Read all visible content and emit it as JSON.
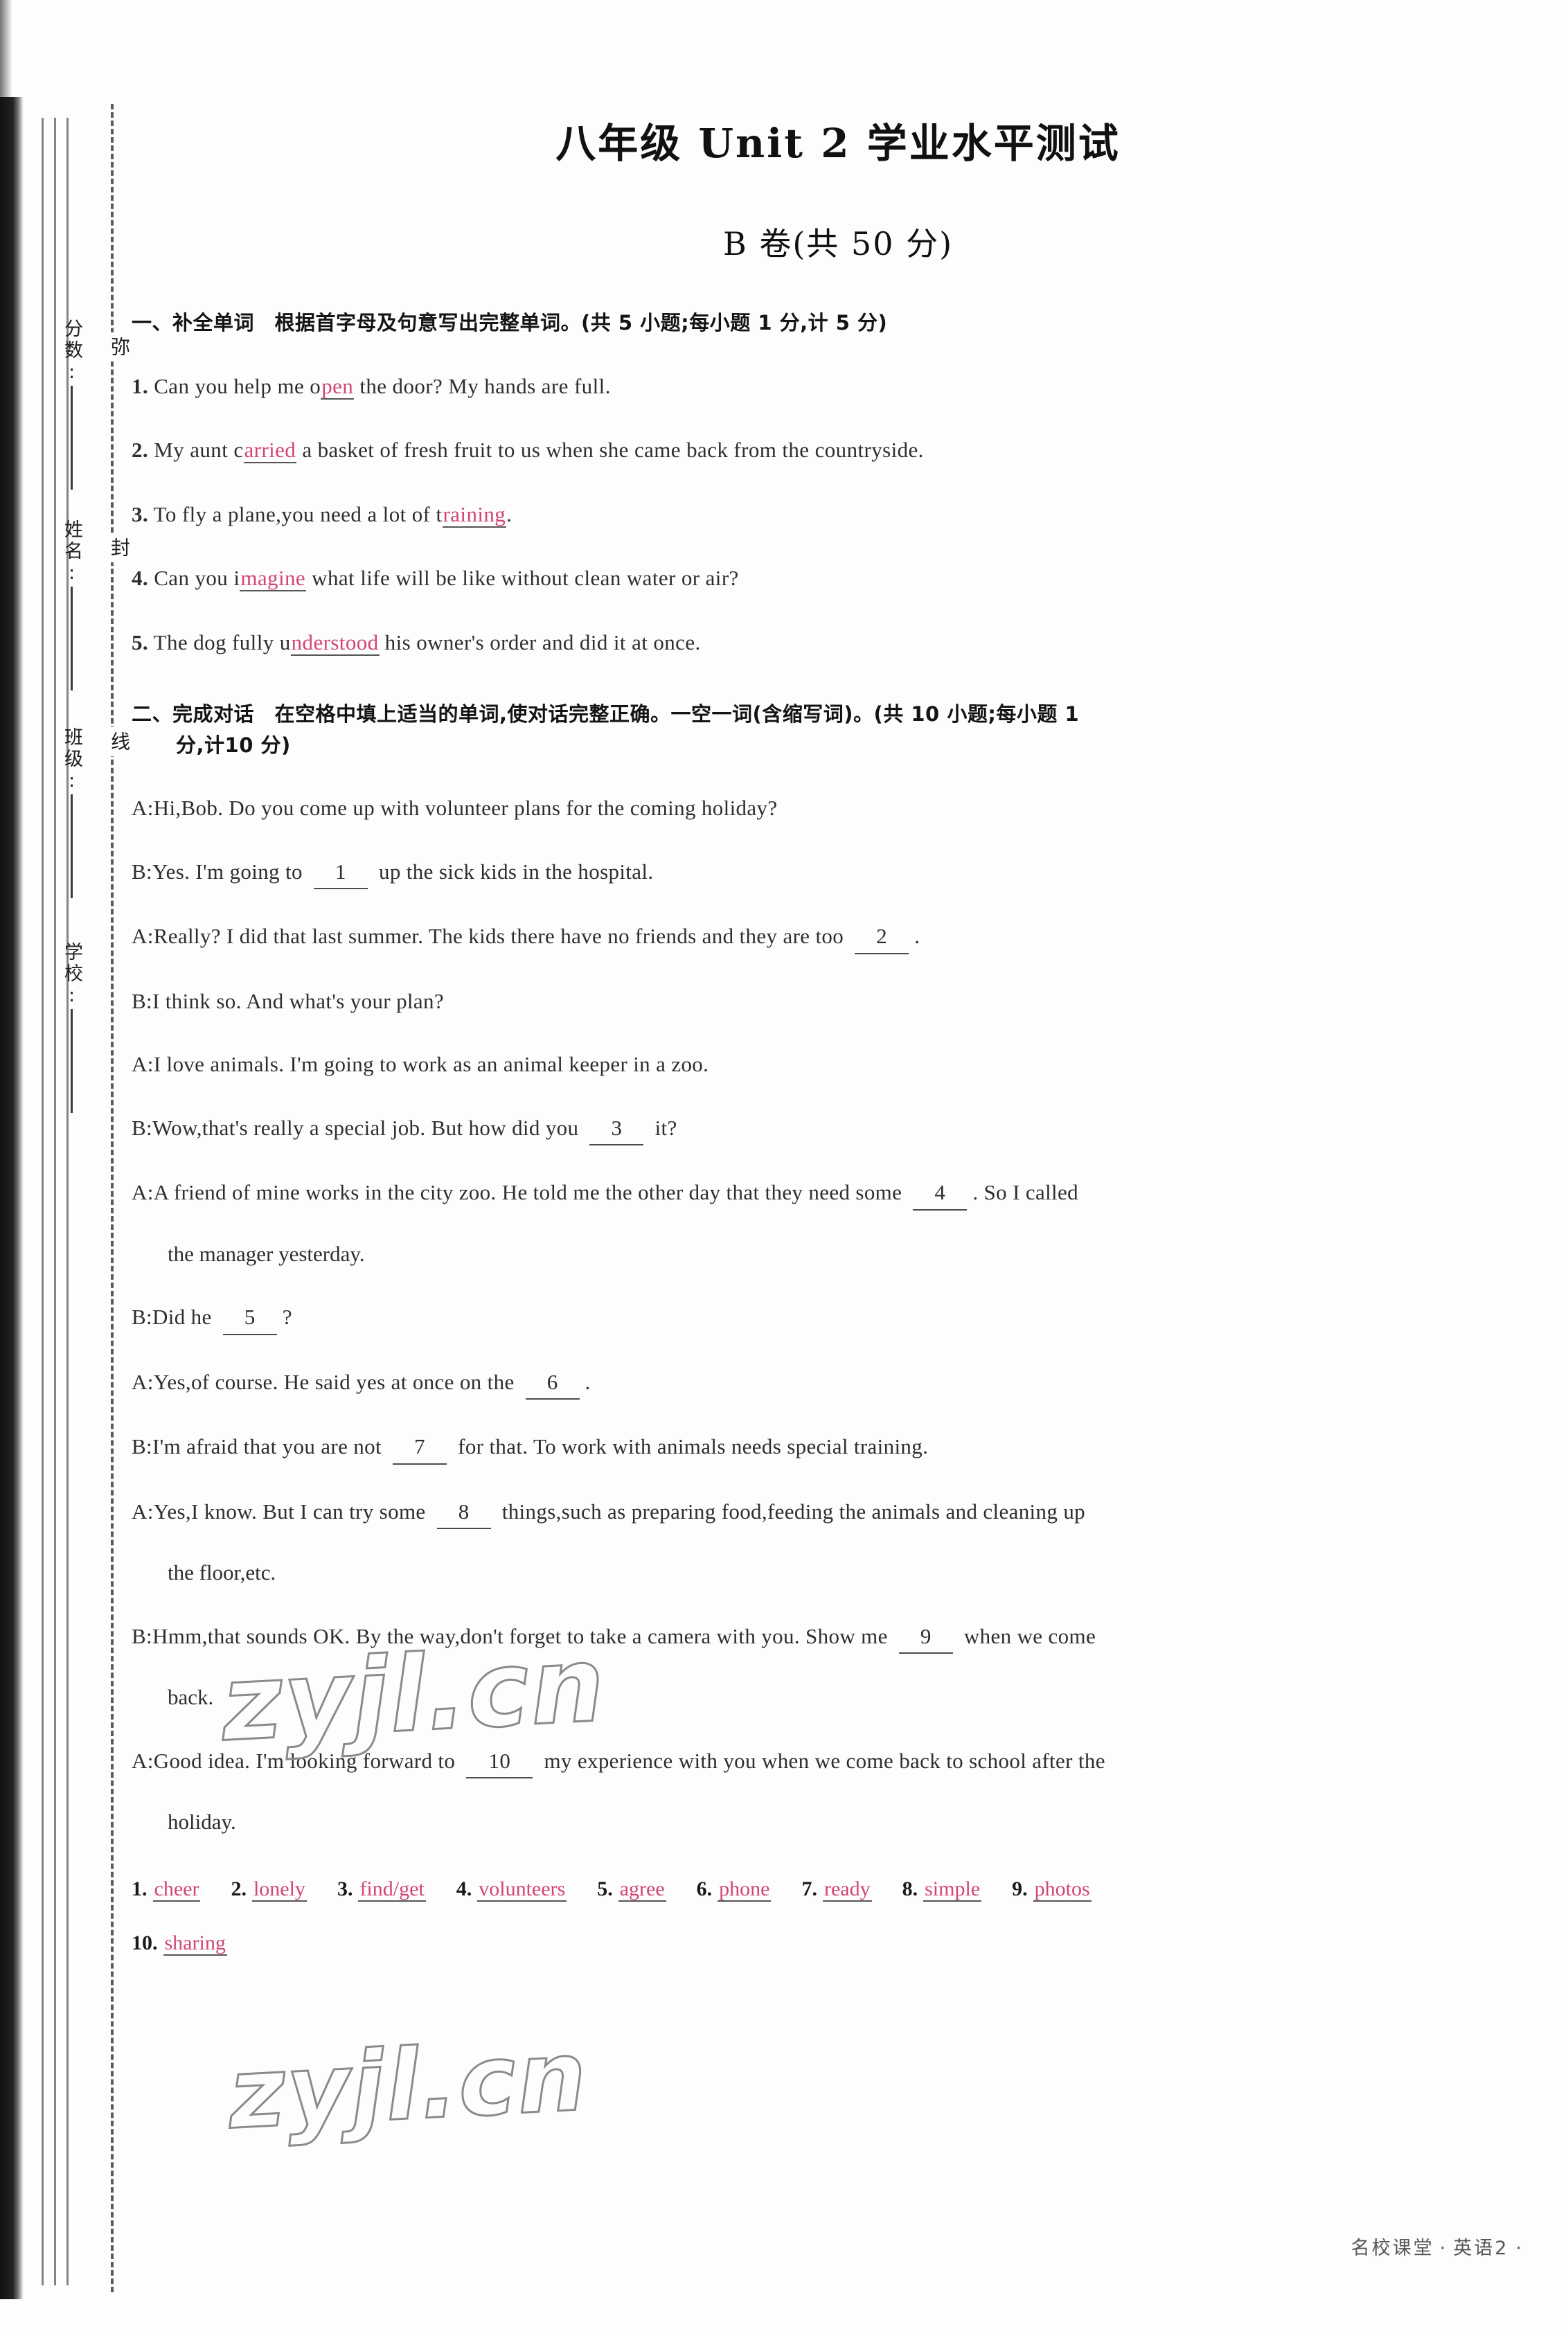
{
  "document": {
    "title": "八年级 Unit 2 学业水平测试",
    "subtitle": "B 卷(共 50 分)"
  },
  "margin": {
    "fields": [
      {
        "label": "分数:"
      },
      {
        "label": "姓名:"
      },
      {
        "label": "班级:"
      },
      {
        "label": "学校:"
      }
    ],
    "seal_words": [
      "弥",
      "封",
      "线"
    ]
  },
  "section1": {
    "heading": "一、补全单词　根据首字母及句意写出完整单词。(共 5 小题;每小题 1 分,计 5 分)",
    "questions": [
      {
        "num": "1.",
        "before": "Can you help me o",
        "answer": "pen",
        "after": " the door? My hands are full."
      },
      {
        "num": "2.",
        "before": "My aunt c",
        "answer": "arried",
        "after": " a basket of fresh fruit to us when she came back from the countryside."
      },
      {
        "num": "3.",
        "before": "To fly a plane,you need a lot of t",
        "answer": "raining",
        "after": "."
      },
      {
        "num": "4.",
        "before": "Can you i",
        "answer": "magine",
        "after": " what life will be like without clean water or air?"
      },
      {
        "num": "5.",
        "before": "The dog fully u",
        "answer": "nderstood",
        "after": " his owner's order and did it at once."
      }
    ]
  },
  "section2": {
    "heading": "二、完成对话　在空格中填上适当的单词,使对话完整正确。一空一词(含缩写词)。(共 10 小题;每小题 1",
    "heading_cont": "分,计10 分)",
    "lines": [
      {
        "speaker": "A:",
        "pre": "Hi,Bob. Do you come up with volunteer plans for the coming holiday?",
        "blank": "",
        "post": ""
      },
      {
        "speaker": "B:",
        "pre": "Yes. I'm going to ",
        "blank": "1",
        "post": " up the sick kids in the hospital."
      },
      {
        "speaker": "A:",
        "pre": "Really? I did that last summer. The kids there have no friends and they are too ",
        "blank": "2",
        "post": "."
      },
      {
        "speaker": "B:",
        "pre": "I think so. And what's your plan?",
        "blank": "",
        "post": ""
      },
      {
        "speaker": "A:",
        "pre": "I love animals. I'm going to work as an animal keeper in a zoo.",
        "blank": "",
        "post": ""
      },
      {
        "speaker": "B:",
        "pre": "Wow,that's really a special job. But how did you ",
        "blank": "3",
        "post": " it?"
      },
      {
        "speaker": "A:",
        "pre": "A friend of mine works in the city zoo. He told me the other day that they need some ",
        "blank": "4",
        "post": ". So I called",
        "cont": "the manager yesterday."
      },
      {
        "speaker": "B:",
        "pre": "Did he ",
        "blank": "5",
        "post": "?"
      },
      {
        "speaker": "A:",
        "pre": "Yes,of course. He said yes at once on the ",
        "blank": "6",
        "post": "."
      },
      {
        "speaker": "B:",
        "pre": "I'm afraid that you are not ",
        "blank": "7",
        "post": " for that. To work with animals needs special training."
      },
      {
        "speaker": "A:",
        "pre": "Yes,I know. But I can try some ",
        "blank": "8",
        "post": " things,such as preparing food,feeding the animals and cleaning up",
        "cont": "the floor,etc."
      },
      {
        "speaker": "B:",
        "pre": "Hmm,that sounds OK. By the way,don't forget to take a camera with you. Show me ",
        "blank": "9",
        "post": " when we come",
        "cont": "back."
      },
      {
        "speaker": "A:",
        "pre": "Good idea. I'm looking forward to ",
        "blank": "10",
        "post": " my experience with you when we come back to school after the",
        "cont": "holiday."
      }
    ],
    "answers": [
      {
        "num": "1.",
        "value": "cheer"
      },
      {
        "num": "2.",
        "value": "lonely"
      },
      {
        "num": "3.",
        "value": "find/get"
      },
      {
        "num": "4.",
        "value": "volunteers"
      },
      {
        "num": "5.",
        "value": "agree"
      },
      {
        "num": "6.",
        "value": "phone"
      },
      {
        "num": "7.",
        "value": "ready"
      },
      {
        "num": "8.",
        "value": "simple"
      },
      {
        "num": "9.",
        "value": "photos"
      },
      {
        "num": "10.",
        "value": "sharing"
      }
    ]
  },
  "footer": {
    "brand": "名校课堂",
    "dot": "·",
    "subject": "英语2",
    "page": "·"
  },
  "watermark": {
    "text": "zyjl.cn"
  },
  "colors": {
    "answer_ink": "#d1447a",
    "body_ink": "#2e2e2e"
  }
}
